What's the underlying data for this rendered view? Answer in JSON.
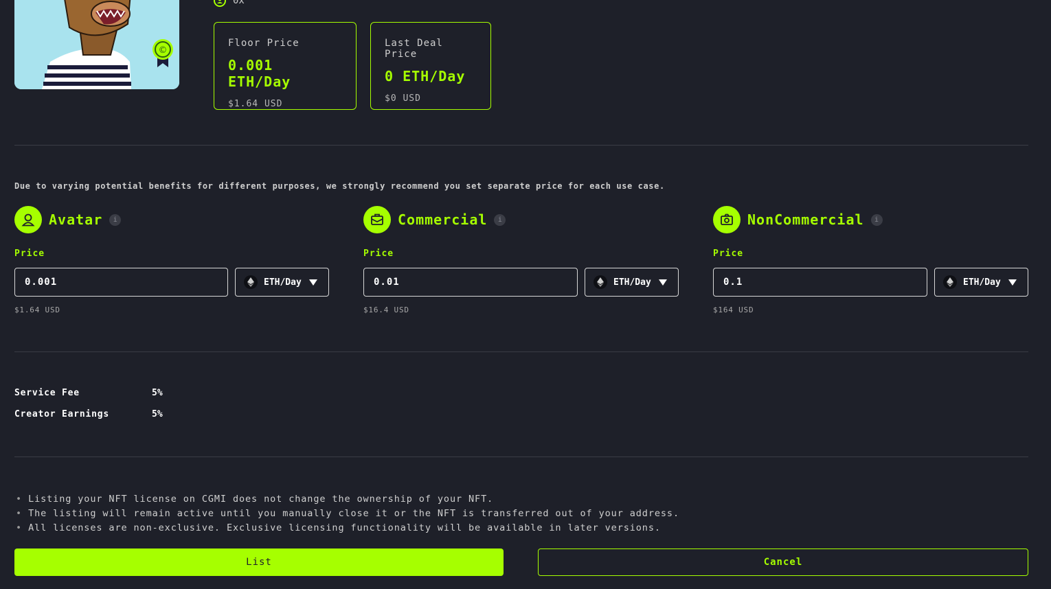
{
  "owner": {
    "address": "0x"
  },
  "stats": [
    {
      "label": "Floor Price",
      "value": "0.001 ETH/Day",
      "usd": "$1.64 USD"
    },
    {
      "label": "Last Deal Price",
      "value": "0 ETH/Day",
      "usd": "$0 USD"
    }
  ],
  "notice": "Due to varying potential benefits for different purposes, we strongly recommend you set separate price for each use case.",
  "usecases": [
    {
      "title": "Avatar",
      "price_label": "Price",
      "price": "0.001",
      "unit": "ETH/Day",
      "usd": "$1.64 USD"
    },
    {
      "title": "Commercial",
      "price_label": "Price",
      "price": "0.01",
      "unit": "ETH/Day",
      "usd": "$16.4 USD"
    },
    {
      "title": "NonCommercial",
      "price_label": "Price",
      "price": "0.1",
      "unit": "ETH/Day",
      "usd": "$164 USD"
    }
  ],
  "info_glyph": "i",
  "fees": [
    {
      "label": "Service Fee",
      "value": "5%"
    },
    {
      "label": "Creator Earnings",
      "value": "5%"
    }
  ],
  "notes": [
    "Listing your NFT license on CGMI does not change the ownership of your NFT.",
    "The listing will remain active until you manually close it or the NFT is transferred out of your address.",
    "All licenses are non-exclusive. Exclusive licensing functionality will be available in later versions."
  ],
  "buttons": {
    "list": "List",
    "cancel": "Cancel"
  },
  "colors": {
    "accent": "#a6ff00",
    "background": "#1e2029"
  }
}
